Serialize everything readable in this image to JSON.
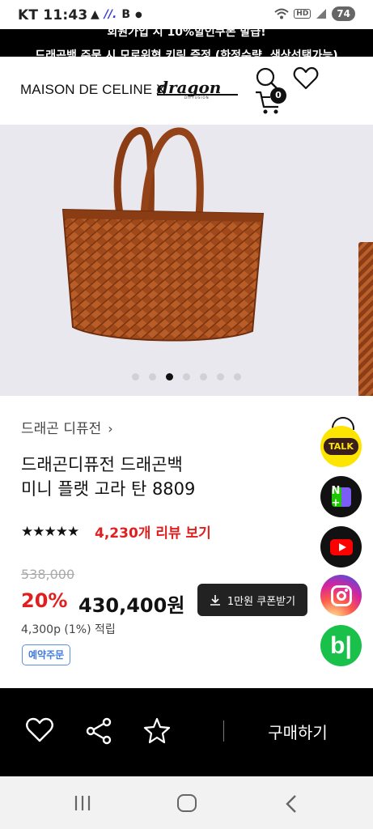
{
  "status_bar": {
    "carrier": "KT",
    "time": "11:43",
    "left_icons": [
      "warning-icon",
      "app-icon",
      "b-icon",
      "dot-icon"
    ],
    "right_icons": [
      "wifi-icon",
      "hd-icon",
      "signal-icon"
    ],
    "battery": "74"
  },
  "banner": {
    "line1": "회원가입 시 10%할인쿠폰 발급!",
    "line2": "드래곤백 주문 시 모로위혁 키링 증정 (한정수량, 색상선택가능)"
  },
  "header": {
    "brand_left": "MAISON DE CELINE X",
    "logo": "dragon",
    "logo_sub": "DIFFUSION",
    "cart_count": "0"
  },
  "gallery": {
    "dot_count": 7,
    "active_index": 2,
    "image_subject": "woven leather tote bag, tan"
  },
  "product": {
    "brand_link": "드래곤 디퓨전",
    "title_line1": "드래곤디퓨전 드래곤백",
    "title_line2": "미니 플랫 고라 탄 8809",
    "rating": 4.5,
    "stars_text": "★★★★★",
    "reviews": "4,230개 리뷰 보기",
    "original_price": "538,000",
    "discount": "20%",
    "price": "430,400원",
    "coupon_label": "1만원 쿠폰받기",
    "points": "4,300p (1%) 적립",
    "badge": "예약주문"
  },
  "floating": {
    "talk_label": "TALK",
    "naver_label": "N +",
    "band_label": "b|"
  },
  "bottom_bar": {
    "buy_label": "구매하기"
  },
  "colors": {
    "accent_red": "#e02020",
    "kakao_yellow": "#fde500",
    "band_green": "#19c14b",
    "badge_blue": "#3f7be0"
  }
}
